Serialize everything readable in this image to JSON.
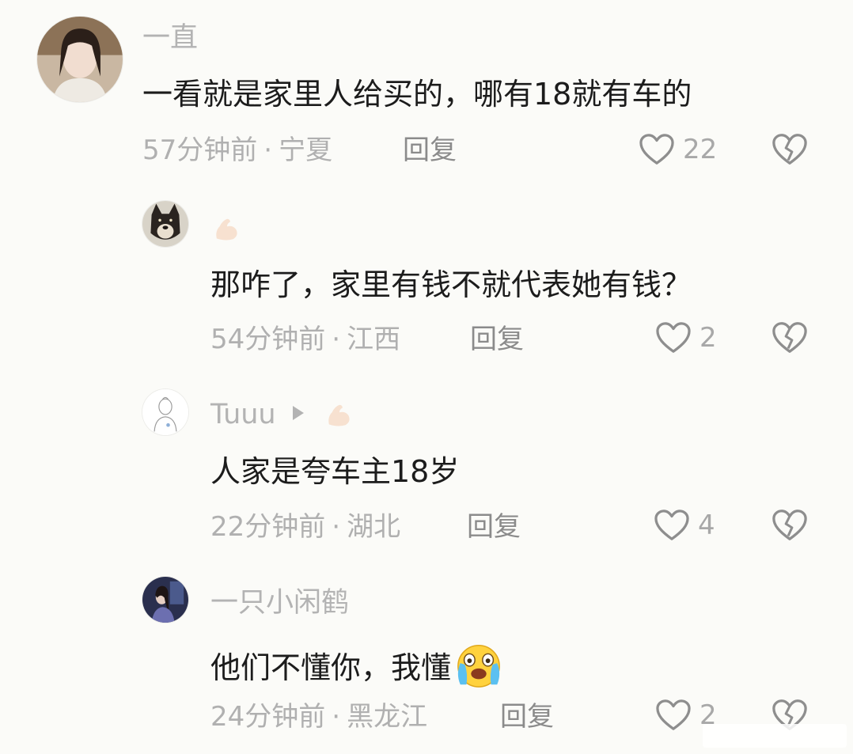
{
  "comments": [
    {
      "author": "一直",
      "text": "一看就是家里人给买的，哪有18就有车的",
      "time": "57分钟前",
      "location": "宁夏",
      "reply_label": "回复",
      "likes": "22"
    },
    {
      "author": "",
      "text": "那咋了，家里有钱不就代表她有钱？",
      "time": "54分钟前",
      "location": "江西",
      "reply_label": "回复",
      "likes": "2"
    },
    {
      "author": "Tuuu",
      "text": "人家是夸车主18岁",
      "time": "22分钟前",
      "location": "湖北",
      "reply_label": "回复",
      "likes": "4"
    },
    {
      "author": "一只小闲鹤",
      "text": "他们不懂你，我懂",
      "time": "24分钟前",
      "location": "黑龙江",
      "reply_label": "回复",
      "likes": "2"
    }
  ],
  "meta_separator": "·",
  "icons": {
    "like": "heart-outline-icon",
    "dislike": "broken-heart-icon",
    "badge": "muscle-emoji-icon",
    "arrow": "play-arrow-icon",
    "crying_emoji": "crying-face-emoji-icon"
  },
  "colors": {
    "background": "#fbfbf8",
    "muted_text": "#b0b0b0",
    "main_text": "#1c1c1c"
  }
}
